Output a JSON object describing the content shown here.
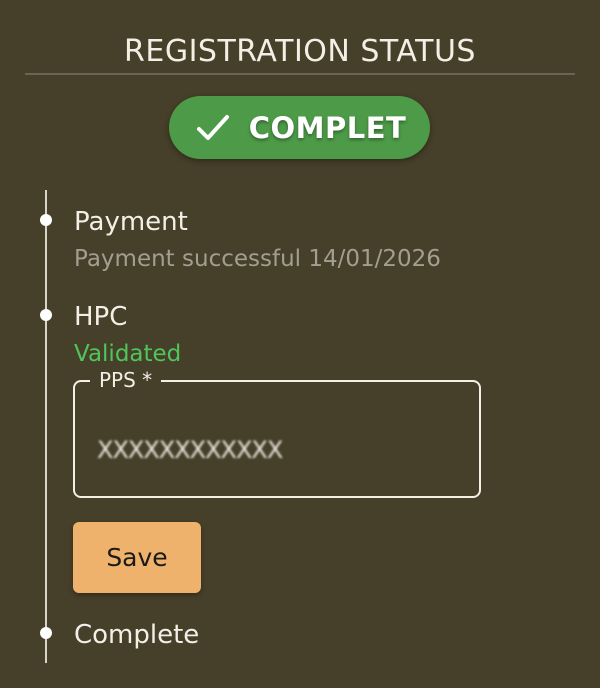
{
  "header": {
    "title": "REGISTRATION STATUS"
  },
  "status_badge": {
    "icon": "checkmark-icon",
    "label": "COMPLET",
    "color": "#4d9b48"
  },
  "timeline": {
    "steps": [
      {
        "label": "Payment",
        "detail": "Payment successful 14/01/2026"
      },
      {
        "label": "HPC",
        "detail": "Validated",
        "detail_color": "#4fc55a",
        "field": {
          "label": "PPS *",
          "value": "XXXXXXXXXXXX"
        },
        "save_label": "Save"
      },
      {
        "label": "Complete"
      }
    ]
  },
  "colors": {
    "background": "#463f29",
    "save_button": "#eeb26c",
    "validated": "#4fc55a"
  }
}
